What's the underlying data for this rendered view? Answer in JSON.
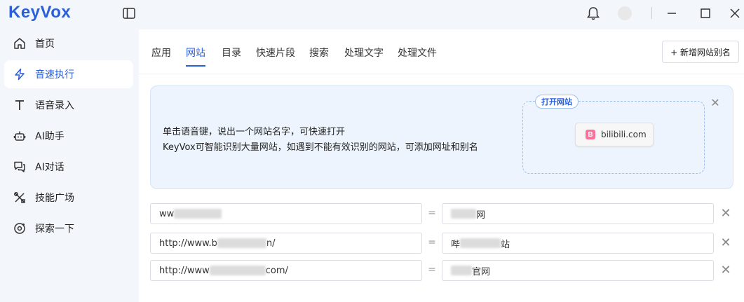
{
  "app": {
    "logo_text": "KeyVox"
  },
  "sidebar": {
    "items": [
      {
        "label": "首页",
        "icon": "home-icon"
      },
      {
        "label": "音速执行",
        "icon": "lightning-icon",
        "active": true
      },
      {
        "label": "语音录入",
        "icon": "text-icon"
      },
      {
        "label": "AI助手",
        "icon": "robot-icon"
      },
      {
        "label": "AI对话",
        "icon": "chat-icon"
      },
      {
        "label": "技能广场",
        "icon": "tools-icon"
      },
      {
        "label": "探索一下",
        "icon": "explore-icon"
      }
    ]
  },
  "tabs": [
    {
      "label": "应用"
    },
    {
      "label": "网站",
      "active": true
    },
    {
      "label": "目录"
    },
    {
      "label": "快速片段"
    },
    {
      "label": "搜索"
    },
    {
      "label": "处理文字"
    },
    {
      "label": "处理文件"
    }
  ],
  "toolbar": {
    "add_label": "+ 新增网站别名"
  },
  "info": {
    "line1": "单击语音键，说出一个网站名字，可快速打开",
    "line2": "KeyVox可智能识别大量网站，如遇到不能有效识别的网站，可添加网址和别名",
    "preview_tag": "打开网站",
    "preview_site": "bilibili.com",
    "bili_glyph": "B"
  },
  "aliases": [
    {
      "url_prefix": "ww",
      "url_suffix": "",
      "eq": "=",
      "name_prefix": "",
      "name_suffix": "网"
    },
    {
      "url_prefix": "http://www.b",
      "url_suffix": "n/",
      "eq": "=",
      "name_prefix": "哔",
      "name_suffix": "站"
    },
    {
      "url_prefix": "http://www",
      "url_suffix": "com/",
      "eq": "=",
      "name_prefix": "",
      "name_suffix": "官网"
    }
  ],
  "colors": {
    "accent": "#2b5fd9",
    "bili": "#fb7299"
  }
}
